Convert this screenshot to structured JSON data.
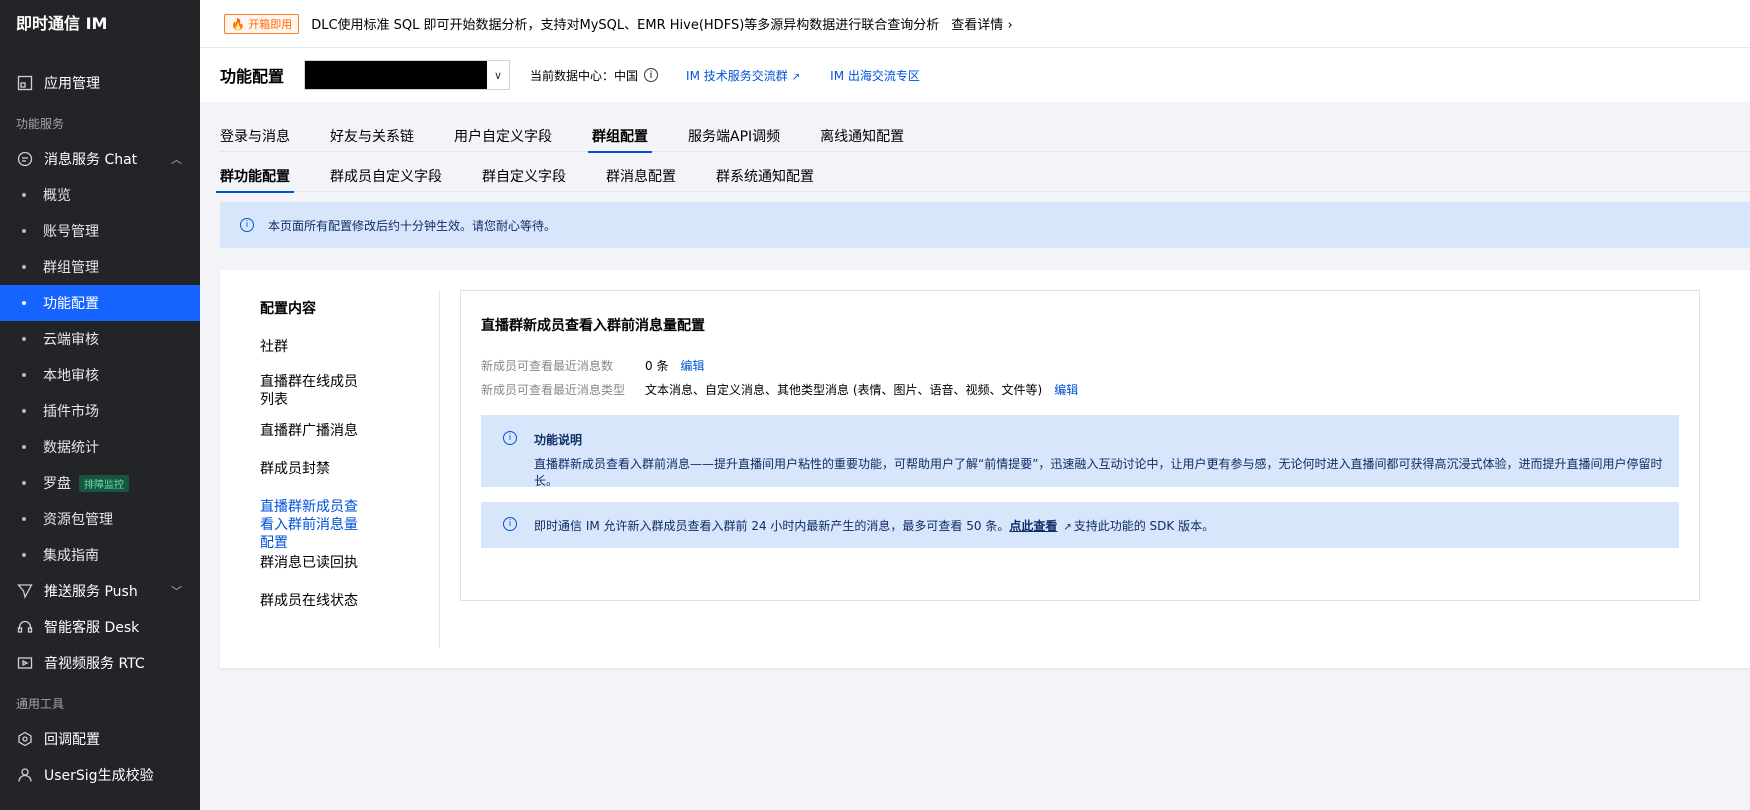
{
  "sidebar": {
    "brand": "即时通信 IM",
    "app_manage": "应用管理",
    "section_features": "功能服务",
    "chat": "消息服务 Chat",
    "chat_items": [
      "概览",
      "账号管理",
      "群组管理",
      "功能配置",
      "云端审核",
      "本地审核",
      "插件市场",
      "数据统计",
      "罗盘",
      "资源包管理",
      "集成指南"
    ],
    "compass_badge": "排障监控",
    "push": "推送服务 Push",
    "desk": "智能客服 Desk",
    "rtc": "音视频服务 RTC",
    "section_tools": "通用工具",
    "callback": "回调配置",
    "usersig": "UserSig生成校验",
    "active_item": "功能配置"
  },
  "banner": {
    "tag": "开箱即用",
    "text": "DLC使用标准 SQL 即可开始数据分析，支持对MySQL、EMR Hive(HDFS)等多源异构数据进行联合查询分析",
    "detail": "查看详情"
  },
  "header": {
    "title": "功能配置",
    "datacenter_label": "当前数据中心：",
    "datacenter_value": "中国",
    "link1": "IM 技术服务交流群",
    "link2": "IM 出海交流专区"
  },
  "tabs": [
    "登录与消息",
    "好友与关系链",
    "用户自定义字段",
    "群组配置",
    "服务端API调频",
    "离线通知配置"
  ],
  "active_tab": "群组配置",
  "subtabs": [
    "群功能配置",
    "群成员自定义字段",
    "群自定义字段",
    "群消息配置",
    "群系统通知配置"
  ],
  "active_subtab": "群功能配置",
  "alert": "本页面所有配置修改后约十分钟生效。请您耐心等待。",
  "nav": {
    "head": "配置内容",
    "items": [
      "社群",
      "直播群在线成员列表",
      "直播群广播消息",
      "群成员封禁",
      "直播群新成员查看入群前消息量配置",
      "群消息已读回执",
      "群成员在线状态"
    ],
    "active": "直播群新成员查看入群前消息量配置"
  },
  "panel": {
    "title": "直播群新成员查看入群前消息量配置",
    "row1_label": "新成员可查看最近消息数",
    "row1_value": "0 条",
    "row2_label": "新成员可查看最近消息类型",
    "row2_value": "文本消息、自定义消息、其他类型消息 (表情、图片、语音、视频、文件等)",
    "edit": "编辑",
    "note_title": "功能说明",
    "note_desc": "直播群新成员查看入群前消息——提升直播间用户粘性的重要功能，可帮助用户了解“前情提要”，迅速融入互动讨论中，让用户更有参与感，无论何时进入直播间都可获得高沉浸式体验，进而提升直播间用户停留时长。",
    "note2_pre": "即时通信 IM 允许新入群成员查看入群前 24 小时内最新产生的消息，最多可查看 50 条。",
    "note2_link": "点此查看",
    "note2_post": "支持此功能的 SDK 版本。"
  }
}
